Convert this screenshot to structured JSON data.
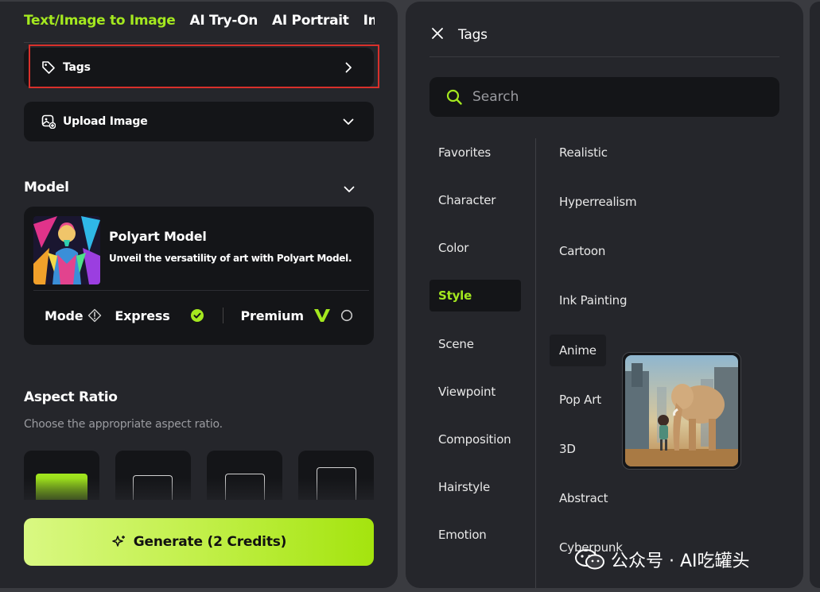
{
  "left": {
    "tabs": [
      {
        "label": "Text/Image to Image",
        "active": true
      },
      {
        "label": "AI Try-On",
        "active": false
      },
      {
        "label": "AI Portrait",
        "active": false
      },
      {
        "label": "Image",
        "active": false
      }
    ],
    "tags_row": {
      "label": "Tags",
      "icon": "tag-icon",
      "chevron": "chevron-right-icon"
    },
    "upload_row": {
      "label": "Upload Image",
      "icon": "upload-image-icon",
      "chevron": "chevron-down-icon"
    },
    "model": {
      "section_title": "Model",
      "name": "Polyart Model",
      "description": "Unveil the versatility of art with Polyart Model.",
      "mode_label": "Mode",
      "express_label": "Express",
      "premium_label": "Premium"
    },
    "aspect": {
      "title": "Aspect Ratio",
      "subtitle": "Choose the appropriate aspect ratio."
    },
    "generate_label": "Generate (2 Credits)"
  },
  "right": {
    "title": "Tags",
    "search_placeholder": "Search",
    "categories": [
      {
        "label": "Favorites",
        "active": false
      },
      {
        "label": "Character",
        "active": false
      },
      {
        "label": "Color",
        "active": false
      },
      {
        "label": "Style",
        "active": true
      },
      {
        "label": "Scene",
        "active": false
      },
      {
        "label": "Viewpoint",
        "active": false
      },
      {
        "label": "Composition",
        "active": false
      },
      {
        "label": "Hairstyle",
        "active": false
      },
      {
        "label": "Emotion",
        "active": false
      }
    ],
    "tags": [
      {
        "label": "Realistic"
      },
      {
        "label": "Hyperrealism"
      },
      {
        "label": "Cartoon"
      },
      {
        "label": "Ink Painting"
      },
      {
        "label": "Anime",
        "hovered": true
      },
      {
        "label": "Pop Art"
      },
      {
        "label": "3D"
      },
      {
        "label": "Abstract"
      },
      {
        "label": "Cyberpunk"
      }
    ]
  },
  "watermark": "公众号 · AI吃罐头",
  "colors": {
    "accent": "#a4e81f",
    "panel_bg": "#25262b",
    "card_bg": "#141518",
    "highlight_border": "#d8302b"
  }
}
